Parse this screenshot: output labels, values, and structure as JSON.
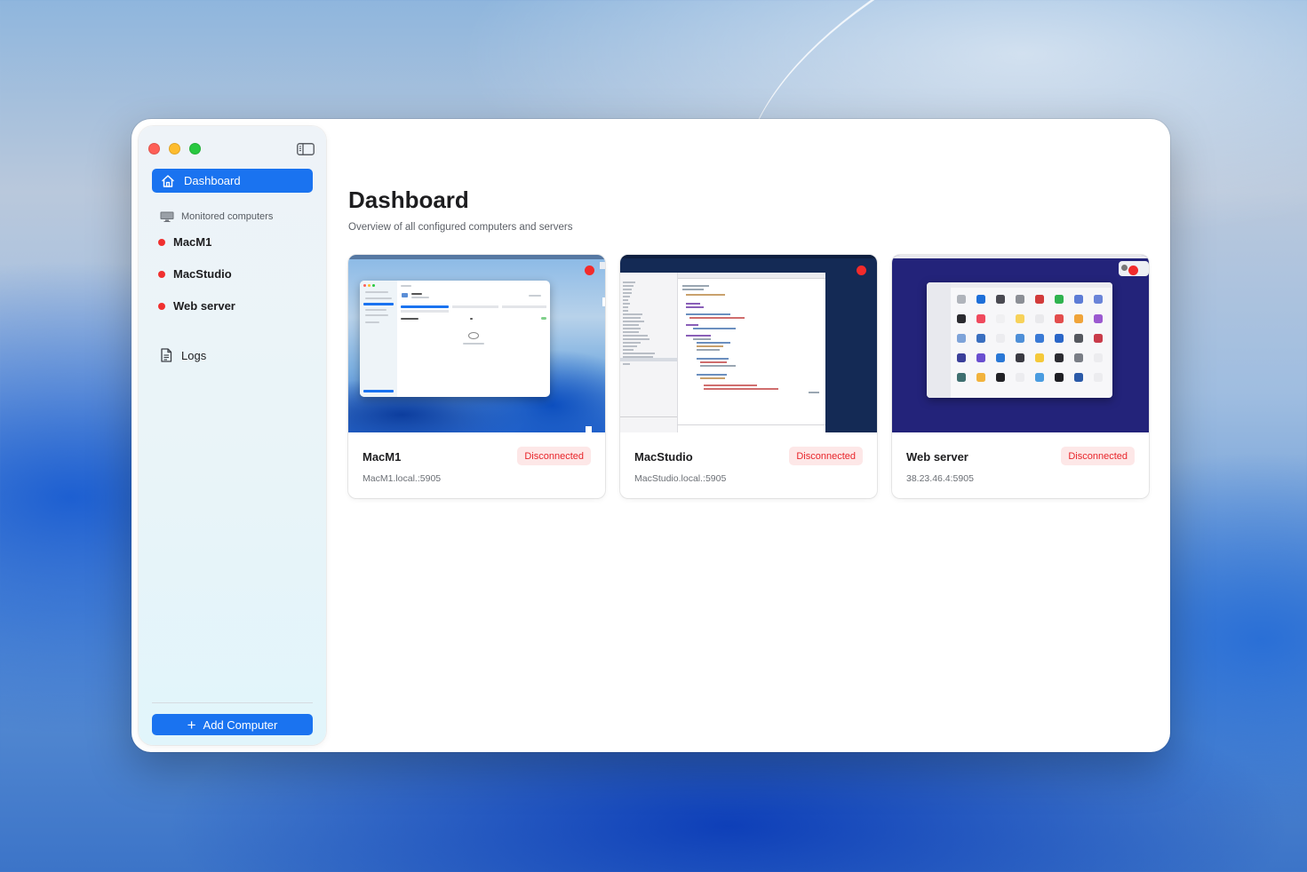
{
  "sidebar": {
    "nav_dashboard": "Dashboard",
    "section_title": "Monitored computers",
    "computers": [
      {
        "name": "MacM1",
        "status_color": "#f0302f"
      },
      {
        "name": "MacStudio",
        "status_color": "#f0302f"
      },
      {
        "name": "Web server",
        "status_color": "#f0302f"
      }
    ],
    "nav_logs": "Logs",
    "add_button": "Add Computer"
  },
  "main": {
    "title": "Dashboard",
    "subtitle": "Overview of all configured computers and servers",
    "cards": [
      {
        "name": "MacM1",
        "address": "MacM1.local.:5905",
        "status": "Disconnected"
      },
      {
        "name": "MacStudio",
        "address": "MacStudio.local.:5905",
        "status": "Disconnected"
      },
      {
        "name": "Web server",
        "address": "38.23.46.4:5905",
        "status": "Disconnected"
      }
    ]
  },
  "colors": {
    "accent": "#1a73f0",
    "status_disconnected": "#e8242a",
    "status_badge_bg": "#fde7e7"
  },
  "icons": {
    "dashboard": "house-icon",
    "section": "monitor-icon",
    "logs": "document-icon",
    "add": "plus-icon",
    "toggle": "sidebar-toggle-icon"
  }
}
